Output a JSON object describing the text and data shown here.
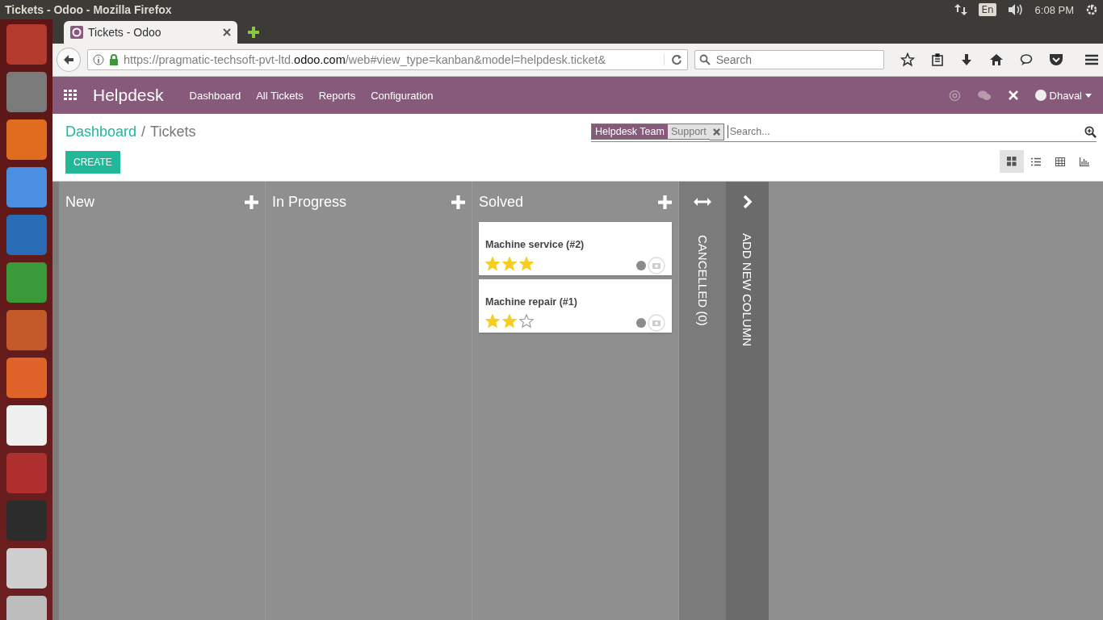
{
  "os_panel": {
    "title": "Tickets - Odoo - Mozilla Firefox",
    "keyboard": "En",
    "time": "6:08 PM"
  },
  "browser": {
    "tab": {
      "title": "Tickets - Odoo"
    },
    "url": {
      "prefix": "https://pragmatic-techsoft-pvt-ltd.",
      "domain": "odoo.com",
      "suffix": "/web#view_type=kanban&model=helpdesk.ticket&"
    },
    "search": {
      "placeholder": "Search"
    }
  },
  "navbar": {
    "app": "Helpdesk",
    "menu": [
      "Dashboard",
      "All Tickets",
      "Reports",
      "Configuration"
    ],
    "user": "Dhaval"
  },
  "breadcrumb": {
    "parent": "Dashboard",
    "separator": "/",
    "current": "Tickets"
  },
  "create_button": "CREATE",
  "search": {
    "facet": {
      "category": "Helpdesk Team",
      "value": "Support"
    },
    "placeholder": "Search..."
  },
  "views": [
    {
      "kind": "kanban",
      "selected": true
    },
    {
      "kind": "list",
      "selected": false
    },
    {
      "kind": "pivot",
      "selected": false
    },
    {
      "kind": "graph",
      "selected": false
    }
  ],
  "columns": [
    {
      "kind": "stage",
      "title": "New"
    },
    {
      "kind": "stage",
      "title": "In Progress"
    },
    {
      "kind": "stage",
      "title": "Solved",
      "cards": [
        {
          "title": "Machine service (#2)",
          "stars": 3
        },
        {
          "title": "Machine repair (#1)",
          "stars": 2
        }
      ]
    },
    {
      "kind": "folded",
      "title": "CANCELLED (0)"
    },
    {
      "kind": "add",
      "title": "ADD NEW COLUMN"
    }
  ]
}
